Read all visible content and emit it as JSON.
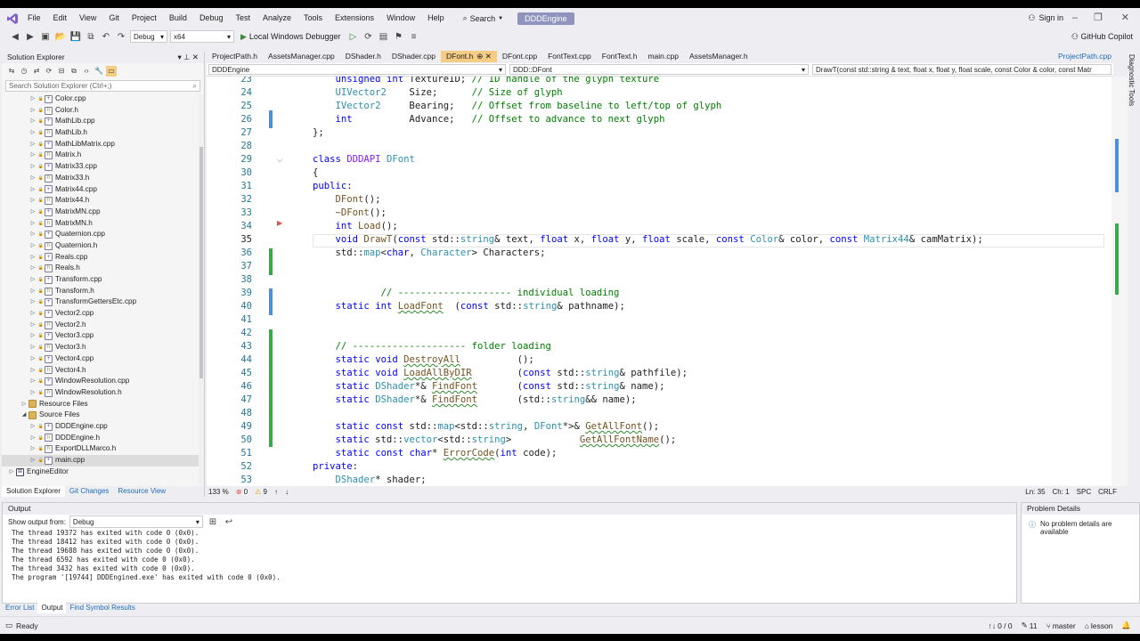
{
  "menubar": {
    "items": [
      "File",
      "Edit",
      "View",
      "Git",
      "Project",
      "Build",
      "Debug",
      "Test",
      "Analyze",
      "Tools",
      "Extensions",
      "Window",
      "Help"
    ],
    "search_label": "Search",
    "solution_name": "DDDEngine",
    "signin_label": "Sign in"
  },
  "toolbar": {
    "config": "Debug",
    "platform": "x64",
    "run_label": "Local Windows Debugger",
    "copilot_label": "GitHub Copilot"
  },
  "solution_explorer": {
    "title": "Solution Explorer",
    "search_placeholder": "Search Solution Explorer (Ctrl+;)",
    "items": [
      {
        "label": "Color.cpp",
        "type": "cpp",
        "indent": 2
      },
      {
        "label": "Color.h",
        "type": "h",
        "indent": 2
      },
      {
        "label": "MathLib.cpp",
        "type": "cpp",
        "indent": 2
      },
      {
        "label": "MathLib.h",
        "type": "h",
        "indent": 2
      },
      {
        "label": "MathLibMatrix.cpp",
        "type": "cpp",
        "indent": 2
      },
      {
        "label": "Matrix.h",
        "type": "h",
        "indent": 2
      },
      {
        "label": "Matrix33.cpp",
        "type": "cpp",
        "indent": 2
      },
      {
        "label": "Matrix33.h",
        "type": "h",
        "indent": 2
      },
      {
        "label": "Matrix44.cpp",
        "type": "cpp",
        "indent": 2
      },
      {
        "label": "Matrix44.h",
        "type": "h",
        "indent": 2
      },
      {
        "label": "MatrixMN.cpp",
        "type": "cpp",
        "indent": 2
      },
      {
        "label": "MatrixMN.h",
        "type": "h",
        "indent": 2
      },
      {
        "label": "Quaternion.cpp",
        "type": "cpp",
        "indent": 2
      },
      {
        "label": "Quaternion.h",
        "type": "h",
        "indent": 2
      },
      {
        "label": "Reals.cpp",
        "type": "cpp",
        "indent": 2
      },
      {
        "label": "Reals.h",
        "type": "h",
        "indent": 2
      },
      {
        "label": "Transform.cpp",
        "type": "cpp",
        "indent": 2
      },
      {
        "label": "Transform.h",
        "type": "h",
        "indent": 2
      },
      {
        "label": "TransformGettersEtc.cpp",
        "type": "cpp",
        "indent": 2
      },
      {
        "label": "Vector2.cpp",
        "type": "cpp",
        "indent": 2
      },
      {
        "label": "Vector2.h",
        "type": "h",
        "indent": 2
      },
      {
        "label": "Vector3.cpp",
        "type": "cpp",
        "indent": 2
      },
      {
        "label": "Vector3.h",
        "type": "h",
        "indent": 2
      },
      {
        "label": "Vector4.cpp",
        "type": "cpp",
        "indent": 2
      },
      {
        "label": "Vector4.h",
        "type": "h",
        "indent": 2
      },
      {
        "label": "WindowResolution.cpp",
        "type": "cpp",
        "indent": 2
      },
      {
        "label": "WindowResolution.h",
        "type": "h",
        "indent": 2
      },
      {
        "label": "Resource Files",
        "type": "folder",
        "indent": 1
      },
      {
        "label": "Source Files",
        "type": "folder",
        "indent": 1,
        "open": true
      },
      {
        "label": "DDDEngine.cpp",
        "type": "cpp",
        "indent": 2
      },
      {
        "label": "DDDEngine.h",
        "type": "h",
        "indent": 2
      },
      {
        "label": "ExportDLLMarco.h",
        "type": "h",
        "indent": 2
      },
      {
        "label": "main.cpp",
        "type": "cpp",
        "indent": 2,
        "selected": true
      },
      {
        "label": "EngineEditor",
        "type": "proj",
        "indent": 0
      }
    ],
    "bottom_tabs": [
      "Solution Explorer",
      "Git Changes",
      "Resource View"
    ]
  },
  "doc_tabs": [
    "ProjectPath.h",
    "AssetsManager.cpp",
    "DShader.h",
    "DShader.cpp",
    "DFont.h",
    "DFont.cpp",
    "FontText.cpp",
    "FontText.h",
    "main.cpp",
    "AssetsManager.h"
  ],
  "active_tab": "DFont.h",
  "pinned_tab": "ProjectPath.cpp",
  "navbar": {
    "project": "DDDEngine",
    "scope": "DDD::DFont",
    "member": "DrawT(const std::string & text, float x, float y, float scale, const Color & color, const Matr"
  },
  "code": {
    "line_numbers": [
      "23",
      "24",
      "25",
      "26",
      "27",
      "28",
      "29",
      "30",
      "31",
      "32",
      "33",
      "34",
      "35",
      "36",
      "37",
      "38",
      "39",
      "40",
      "41",
      "42",
      "43",
      "44",
      "45",
      "46",
      "47",
      "48",
      "49",
      "50",
      "51",
      "52",
      "53"
    ],
    "current_line": "35"
  },
  "editor_status": {
    "zoom": "133 %",
    "errors": "0",
    "warnings": "9",
    "position": "Ln: 35",
    "col": "Ch: 1",
    "whitespace": "SPC",
    "line_ending": "CRLF"
  },
  "output": {
    "title": "Output",
    "show_from_label": "Show output from:",
    "source": "Debug",
    "lines": [
      "The thread 19372 has exited with code 0 (0x0).",
      "The thread 18412 has exited with code 0 (0x0).",
      "The thread 19688 has exited with code 0 (0x0).",
      "The thread 6592 has exited with code 0 (0x0).",
      "The thread 3432 has exited with code 0 (0x0).",
      "The program '[19744] DDDEngined.exe' has exited with code 0 (0x0)."
    ]
  },
  "problem_details": {
    "title": "Problem Details",
    "message": "No problem details are available"
  },
  "bottom_tabs": [
    "Error List",
    "Output",
    "Find Symbol Results"
  ],
  "statusbar": {
    "ready": "Ready",
    "changes": "0 / 0",
    "edits": "11",
    "branch": "master",
    "repo": "lesson"
  },
  "right_rail": "Diagnostic Tools"
}
